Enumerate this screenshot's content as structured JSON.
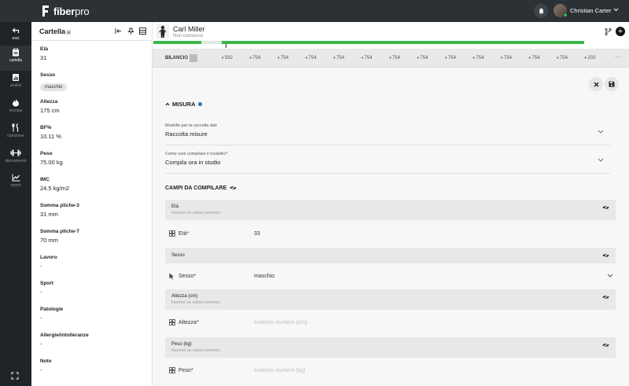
{
  "app": {
    "logo_bold": "fiber",
    "logo_thin": "pro",
    "user_name": "Christian Carter"
  },
  "rail": [
    {
      "label": "esci",
      "icon": "back-arrow-icon"
    },
    {
      "label": "cartella",
      "icon": "clipboard-icon"
    },
    {
      "label": "analisi",
      "icon": "chart-doc-icon"
    },
    {
      "label": "energia",
      "icon": "flame-icon"
    },
    {
      "label": "nutrizione",
      "icon": "cutlery-icon"
    },
    {
      "label": "allenamento",
      "icon": "dumbbell-icon"
    },
    {
      "label": "report",
      "icon": "trend-icon"
    }
  ],
  "panel": {
    "title": "Cartella",
    "fields": [
      {
        "label": "Età",
        "value": "31"
      },
      {
        "label": "Sesso",
        "chip": "maschio"
      },
      {
        "label": "Altezza",
        "value": "175 cm"
      },
      {
        "label": "BF%",
        "value": "10.11 %"
      },
      {
        "label": "Peso",
        "value": "75.00 kg"
      },
      {
        "label": "IMC",
        "value": "24.5 kg/m2"
      },
      {
        "label": "Somma pliche-3",
        "value": "31 mm"
      },
      {
        "label": "Somma pliche-7",
        "value": "70 mm"
      },
      {
        "label": "Lavoro",
        "value": "-"
      },
      {
        "label": "Sport",
        "value": "-"
      },
      {
        "label": "Patologie",
        "value": "-"
      },
      {
        "label": "Allergie/intolleranze",
        "value": "-"
      },
      {
        "label": "Note",
        "value": "-"
      }
    ]
  },
  "client": {
    "name": "Carl Miller",
    "status": "Non connesso"
  },
  "bilancio": {
    "label": "BILANCIO",
    "values": [
      "592",
      "754",
      "754",
      "754",
      "754",
      "754",
      "754",
      "754",
      "754",
      "754",
      "754",
      "754",
      "754",
      "203"
    ]
  },
  "form": {
    "section_title": "MISURA",
    "model_label": "Modello per la raccolta dati",
    "model_value": "Raccolta misure",
    "compile_label": "Come vuoi compilare il modello?",
    "compile_value": "Compila ora in studio",
    "campi_title": "CAMPI DA COMPILARE",
    "rows": [
      {
        "title": "Età",
        "subtitle": "Inserisci un valore numerico",
        "label": "Età*",
        "value": "33",
        "placeholder": ""
      },
      {
        "title": "Sesso",
        "subtitle": "",
        "label": "Sesso*",
        "value": "maschio",
        "placeholder": ""
      },
      {
        "title": "Altezza (cm)",
        "subtitle": "Inserisci un valore numerico",
        "label": "Altezza*",
        "value": "",
        "placeholder": "Inserisci numero (cm)"
      },
      {
        "title": "Peso (kg)",
        "subtitle": "Inserisci un valore numerico",
        "label": "Peso*",
        "value": "",
        "placeholder": "Inserisci numero (kg)"
      }
    ]
  },
  "colors": {
    "topbar": "#2b3135",
    "rail": "#1f2427",
    "progress": "#3cb54a",
    "accent_dot": "#1d7fa8"
  }
}
